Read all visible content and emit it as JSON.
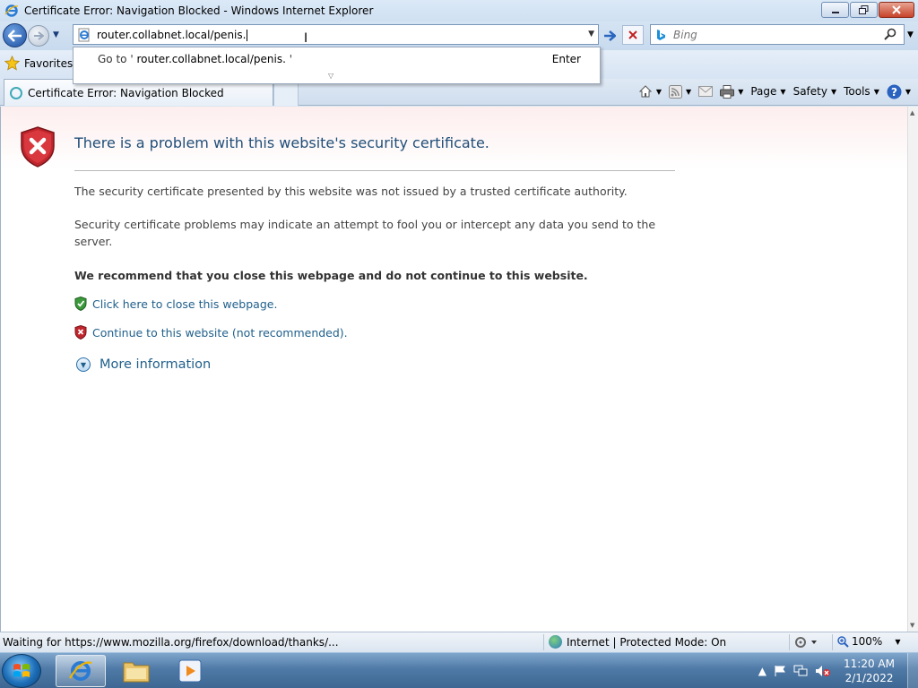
{
  "window": {
    "title": "Certificate Error: Navigation Blocked - Windows Internet Explorer",
    "minimize_label": "▭",
    "restore_label": "❐",
    "close_label": "✕"
  },
  "address": {
    "url": "router.collabnet.local/penis.",
    "search_placeholder": "Bing"
  },
  "autocomplete": {
    "goto_prefix": "Go to '",
    "goto_value": "router.collabnet.local/penis.",
    "goto_suffix": " '",
    "enter_label": "Enter"
  },
  "favorites": {
    "label": "Favorites"
  },
  "tabs": [
    {
      "label": "Certificate Error: Navigation Blocked"
    }
  ],
  "command_bar": {
    "page_label": "Page",
    "safety_label": "Safety",
    "tools_label": "Tools"
  },
  "content": {
    "heading": "There is a problem with this website's security certificate.",
    "para1": "The security certificate presented by this website was not issued by a trusted certificate authority.",
    "para2": "Security certificate problems may indicate an attempt to fool you or intercept any data you send to the server.",
    "recommend": "We recommend that you close this webpage and do not continue to this website.",
    "close_link": "Click here to close this webpage.",
    "continue_link": "Continue to this website (not recommended).",
    "more_info": "More information"
  },
  "status": {
    "text": "Waiting for https://www.mozilla.org/firefox/download/thanks/...",
    "zone": "Internet | Protected Mode: On",
    "zoom": "100%"
  },
  "taskbar": {
    "time": "11:20 AM",
    "date": "2/1/2022"
  },
  "colors": {
    "link": "#1f5f8b",
    "heading": "#1f4e79",
    "shield_red": "#c0262d",
    "shield_green": "#3c9a3c"
  }
}
